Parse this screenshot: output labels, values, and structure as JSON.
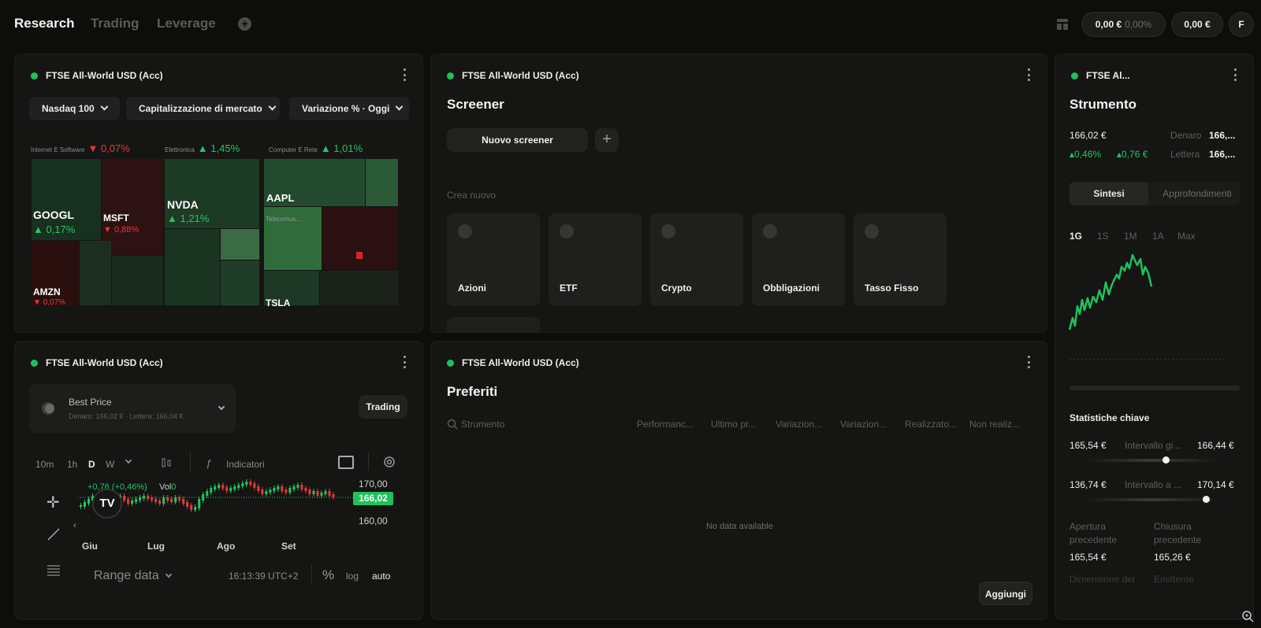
{
  "tabs": [
    {
      "label": "Research",
      "active": true
    },
    {
      "label": "Trading",
      "active": false
    },
    {
      "label": "Leverage",
      "active": false
    }
  ],
  "header": {
    "portfolio_value": "0,00 €",
    "portfolio_change": "0,00%",
    "cash_value": "0,00 €",
    "avatar_initial": "F"
  },
  "heatmap_panel": {
    "title": "FTSE All-World USD (Acc)",
    "filters": [
      "Nasdaq 100",
      "Capitalizzazione di mercato",
      "Variazione % · Oggi"
    ],
    "sectors": [
      {
        "name": "Internet E Software",
        "change": "0,07%",
        "dir": "down"
      },
      {
        "name": "Elettronica",
        "change": "1,45%",
        "dir": "up"
      },
      {
        "name": "Computer E Rete",
        "change": "1,01%",
        "dir": "up"
      }
    ],
    "tiles": [
      {
        "ticker": "GOOGL",
        "change": "0,17%",
        "dir": "up"
      },
      {
        "ticker": "MSFT",
        "change": "0,88%",
        "dir": "down"
      },
      {
        "ticker": "AMZN",
        "change": "0,07%",
        "dir": "down"
      },
      {
        "ticker": "NVDA",
        "change": "1,21%",
        "dir": "up"
      },
      {
        "ticker": "AAPL"
      },
      {
        "ticker": "TSLA"
      },
      {
        "ticker": "Telecomun..."
      }
    ]
  },
  "screener_panel": {
    "title": "FTSE All-World USD (Acc)",
    "heading": "Screener",
    "new_button": "Nuovo screener",
    "create_label": "Crea nuovo",
    "cards": [
      "Azioni",
      "ETF",
      "Crypto",
      "Obbligazioni",
      "Tasso Fisso"
    ]
  },
  "instrument_panel": {
    "title": "FTSE Al...",
    "heading": "Strumento",
    "price": "166,02 €",
    "change_pct": "0,46%",
    "change_abs": "0,76 €",
    "bid_label": "Denaro",
    "bid_value": "166,...",
    "ask_label": "Lettera",
    "ask_value": "166,...",
    "seg_tabs": [
      "Sintesi",
      "Approfondimenti"
    ],
    "periods": [
      "1G",
      "1S",
      "1M",
      "1A",
      "Max"
    ],
    "stats_heading": "Statistiche chiave",
    "stats": [
      {
        "low": "165,54 €",
        "label": "Intervallo gi...",
        "high": "166,44 €",
        "position": 0.6
      },
      {
        "low": "136,74 €",
        "label": "Intervallo a ...",
        "high": "170,14 €",
        "position": 0.9
      }
    ],
    "kv": [
      {
        "label": "Apertura precedente",
        "value": "165,54 €"
      },
      {
        "label": "Chiusura precedente",
        "value": "165,26 €"
      }
    ],
    "kv_more": [
      "Dimensione del",
      "Emittente"
    ]
  },
  "trading_panel": {
    "title": "FTSE All-World USD (Acc)",
    "venue_name": "Best Price",
    "venue_sub": "Denaro: 166,02 € · Lettera: 166,04 €",
    "trading_button": "Trading",
    "intervals": [
      "10m",
      "1h",
      "D",
      "W"
    ],
    "indicators_label": "Indicatori",
    "legend_change": "+0,76 (+0,46%)",
    "legend_vol_label": "Vol",
    "legend_vol_value": "0",
    "price_ticks": [
      "170,00",
      "160,00"
    ],
    "last_price": "166,02",
    "x_ticks": [
      "Giu",
      "Lug",
      "Ago",
      "Set"
    ],
    "range_label": "Range data",
    "clock": "16:13:39 UTC+2",
    "scale_pct": "%",
    "scale_log": "log",
    "scale_auto": "auto"
  },
  "favorites_panel": {
    "title": "FTSE All-World USD (Acc)",
    "heading": "Preferiti",
    "search_placeholder": "Strumento",
    "columns": [
      "Performanc...",
      "Ultimo pr...",
      "Variazion...",
      "Variazion...",
      "Realizzato...",
      "Non realiz..."
    ],
    "empty_text": "No data available",
    "add_button": "Aggiungi"
  },
  "colors": {
    "accent_green": "#27c461",
    "accent_red": "#e5383b"
  }
}
